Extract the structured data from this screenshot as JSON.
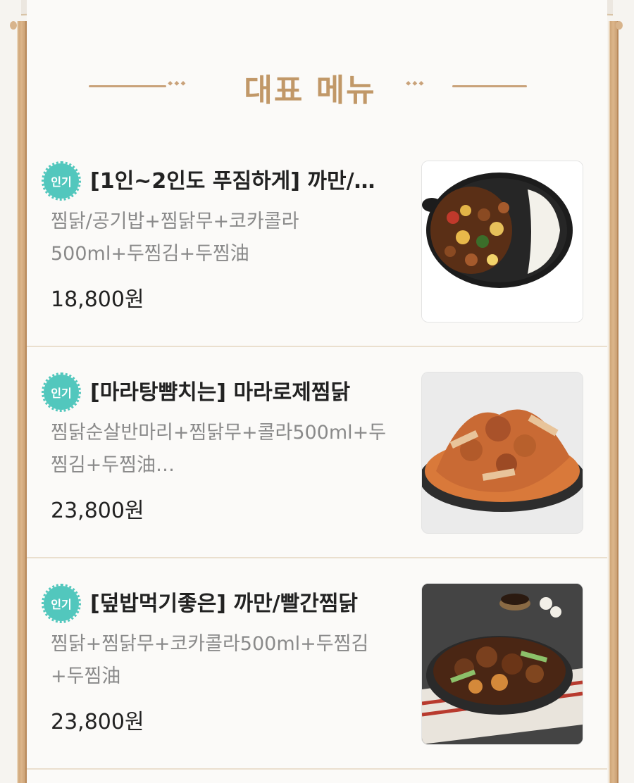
{
  "section": {
    "title": "대표 메뉴",
    "diamonds_left": "⬩⬩⬩",
    "diamonds_right": "⬩⬩⬩"
  },
  "items": [
    {
      "badge": "인기",
      "name": "[1인~2인도 푸짐하게] 까만/…",
      "desc_line1": "찜닭/공기밥+찜닭무+코카콜라",
      "desc_line2": "500ml+두찜김+두찜油",
      "price": "18,800원",
      "image_icon": "black-jjimdak-rice-bowl-photo"
    },
    {
      "badge": "인기",
      "name": "[마라탕뺨치는] 마라로제찜닭",
      "desc_line1": "찜닭순살반마리+찜닭무+콜라500ml+두",
      "desc_line2": "찜김+두찜油…",
      "price": "23,800원",
      "image_icon": "mala-rose-jjimdak-photo"
    },
    {
      "badge": "인기",
      "name": "[덮밥먹기좋은] 까만/빨간찜닭",
      "desc_line1": "찜닭+찜닭무+코카콜라500ml+두찜김",
      "desc_line2": "+두찜油",
      "price": "23,800원",
      "image_icon": "black-red-jjimdak-photo"
    }
  ],
  "colors": {
    "accent_gold": "#c19868",
    "frame": "#d8b48c",
    "badge_teal": "#52c7bd",
    "text_dark": "#222222",
    "text_grey": "#8a8a8a"
  }
}
